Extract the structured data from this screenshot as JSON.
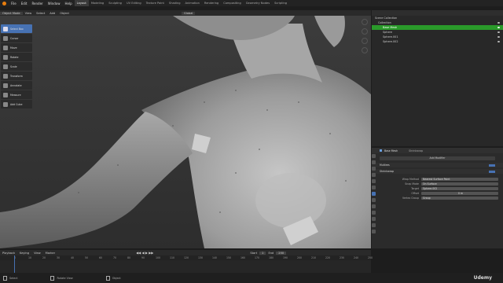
{
  "menus": [
    "File",
    "Edit",
    "Render",
    "Window",
    "Help"
  ],
  "workspaces": [
    "Layout",
    "Modeling",
    "Sculpting",
    "UV Editing",
    "Texture Paint",
    "Shading",
    "Animation",
    "Rendering",
    "Compositing",
    "Geometry Nodes",
    "Scripting"
  ],
  "viewport_header": [
    "Object Mode",
    "View",
    "Select",
    "Add",
    "Object",
    "Global"
  ],
  "tools": [
    "Select Box",
    "Cursor",
    "Move",
    "Rotate",
    "Scale",
    "Transform",
    "Annotate",
    "Measure",
    "Add Cube"
  ],
  "outliner": {
    "root": "Scene Collection",
    "collection": "Collection",
    "items": [
      "Base Mesh",
      "Sphere",
      "Sphere.001",
      "Sphere.002"
    ]
  },
  "properties": {
    "object": "Base Mesh",
    "modifier_tab": "Shrinkwrap",
    "add_modifier": "Add Modifier",
    "modifiers": [
      "Multires",
      "Shrinkwrap"
    ],
    "fields": [
      {
        "label": "Wrap Method",
        "value": "Nearest Surface Point"
      },
      {
        "label": "Snap Mode",
        "value": "On Surface"
      },
      {
        "label": "Target",
        "value": "Sphere.002"
      },
      {
        "label": "Offset",
        "value": "0 m"
      },
      {
        "label": "Vertex Group",
        "value": "Group"
      }
    ]
  },
  "timeline": {
    "menus": [
      "Playback",
      "Keying",
      "View",
      "Marker"
    ],
    "ticks": [
      "0",
      "10",
      "20",
      "30",
      "40",
      "50",
      "60",
      "70",
      "80",
      "90",
      "100",
      "110",
      "120",
      "130",
      "140",
      "150",
      "160",
      "170",
      "180",
      "190",
      "200",
      "210",
      "220",
      "230",
      "240",
      "250"
    ],
    "start_label": "Start",
    "start": "1",
    "end_label": "End",
    "end": "250"
  },
  "status": [
    "Select",
    "Rotate View",
    "Object"
  ],
  "watermark": "Udemy"
}
